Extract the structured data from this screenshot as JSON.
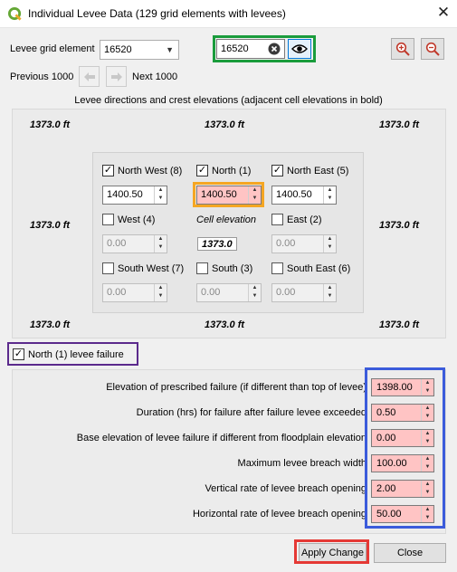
{
  "window": {
    "title": "Individual Levee Data (129 grid elements with levees)",
    "close_glyph": "✕"
  },
  "grid_element": {
    "label": "Levee grid element",
    "selected": "16520",
    "search_value": "16520",
    "previous_label": "Previous 1000",
    "next_label": "Next 1000"
  },
  "directions": {
    "section_title": "Levee directions and crest elevations (adjacent cell elevations in bold)",
    "adjacent_elevation": "1373.0  ft",
    "cell_elevation_label": "Cell elevation",
    "cell_elevation_value": "1373.0",
    "items": {
      "nw": {
        "label": "North West (8)",
        "checked": true,
        "value": "1400.50"
      },
      "n": {
        "label": "North (1)",
        "checked": true,
        "value": "1400.50"
      },
      "ne": {
        "label": "North East (5)",
        "checked": true,
        "value": "1400.50"
      },
      "w": {
        "label": "West (4)",
        "checked": false,
        "value": "0.00"
      },
      "e": {
        "label": "East (2)",
        "checked": false,
        "value": "0.00"
      },
      "sw": {
        "label": "South West (7)",
        "checked": false,
        "value": "0.00"
      },
      "s": {
        "label": "South (3)",
        "checked": false,
        "value": "0.00"
      },
      "se": {
        "label": "South East (6)",
        "checked": false,
        "value": "0.00"
      }
    }
  },
  "failure": {
    "checkbox_label": "North (1)  levee failure",
    "checked": true,
    "params": [
      {
        "label": "Elevation of prescribed failure (if different than top of levee)",
        "value": "1398.00"
      },
      {
        "label": "Duration (hrs) for failure after failure levee exceeded",
        "value": "0.50"
      },
      {
        "label": "Base elevation of levee failure if different from floodplain elevation",
        "value": "0.00"
      },
      {
        "label": "Maximum levee breach width",
        "value": "100.00"
      },
      {
        "label": "Vertical rate of levee breach opening",
        "value": "2.00"
      },
      {
        "label": "Horizontal rate of levee breach opening",
        "value": "50.00"
      }
    ]
  },
  "buttons": {
    "apply": "Apply Change",
    "close": "Close"
  },
  "icons": {
    "app": "qgis-q-icon",
    "clear": "clear-circle-x-icon",
    "eye": "eye-icon",
    "zoom_in": "zoom-in-icon",
    "zoom_out": "zoom-out-icon",
    "prev": "arrow-left-icon",
    "next": "arrow-right-icon"
  },
  "colors": {
    "highlight_green": "#1a9c3c",
    "highlight_orange": "#f5a623",
    "highlight_purple": "#5b2a8c",
    "highlight_blue": "#3b5bdb",
    "highlight_red": "#e53935",
    "invalid_field": "#ffc4c4"
  }
}
